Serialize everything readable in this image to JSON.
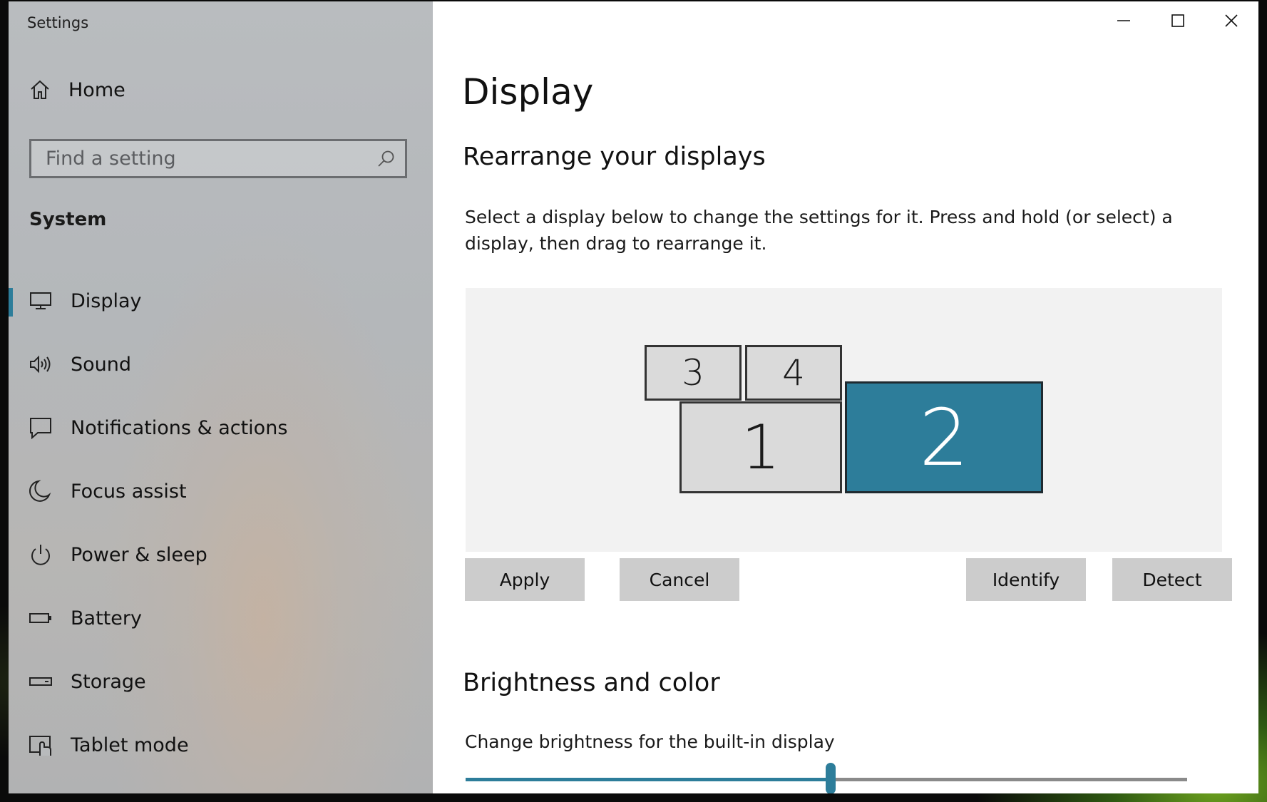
{
  "window": {
    "title": "Settings",
    "minimize_icon": "minimize-icon",
    "maximize_icon": "maximize-icon",
    "close_icon": "close-icon"
  },
  "sidebar": {
    "home_label": "Home",
    "search_placeholder": "Find a setting",
    "section": "System",
    "items": [
      {
        "label": "Display",
        "icon": "monitor-icon",
        "active": true
      },
      {
        "label": "Sound",
        "icon": "speaker-icon",
        "active": false
      },
      {
        "label": "Notifications & actions",
        "icon": "notification-icon",
        "active": false
      },
      {
        "label": "Focus assist",
        "icon": "moon-icon",
        "active": false
      },
      {
        "label": "Power & sleep",
        "icon": "power-icon",
        "active": false
      },
      {
        "label": "Battery",
        "icon": "battery-icon",
        "active": false
      },
      {
        "label": "Storage",
        "icon": "storage-icon",
        "active": false
      },
      {
        "label": "Tablet mode",
        "icon": "tablet-mode-icon",
        "active": false
      }
    ]
  },
  "main": {
    "title": "Display",
    "rearrange": {
      "heading": "Rearrange your displays",
      "description": "Select a display below to change the settings for it. Press and hold (or select) a display, then drag to rearrange it.",
      "monitors": [
        {
          "label": "3",
          "selected": false
        },
        {
          "label": "4",
          "selected": false
        },
        {
          "label": "1",
          "selected": false
        },
        {
          "label": "2",
          "selected": true
        }
      ],
      "buttons": {
        "apply": "Apply",
        "cancel": "Cancel",
        "identify": "Identify",
        "detect": "Detect"
      }
    },
    "brightness": {
      "heading": "Brightness and color",
      "label": "Change brightness for the built-in display",
      "value_fraction": 0.5
    }
  },
  "colors": {
    "accent": "#2d7d9a",
    "monitor_unselected": "#dadada",
    "button_bg": "#cccccc"
  }
}
